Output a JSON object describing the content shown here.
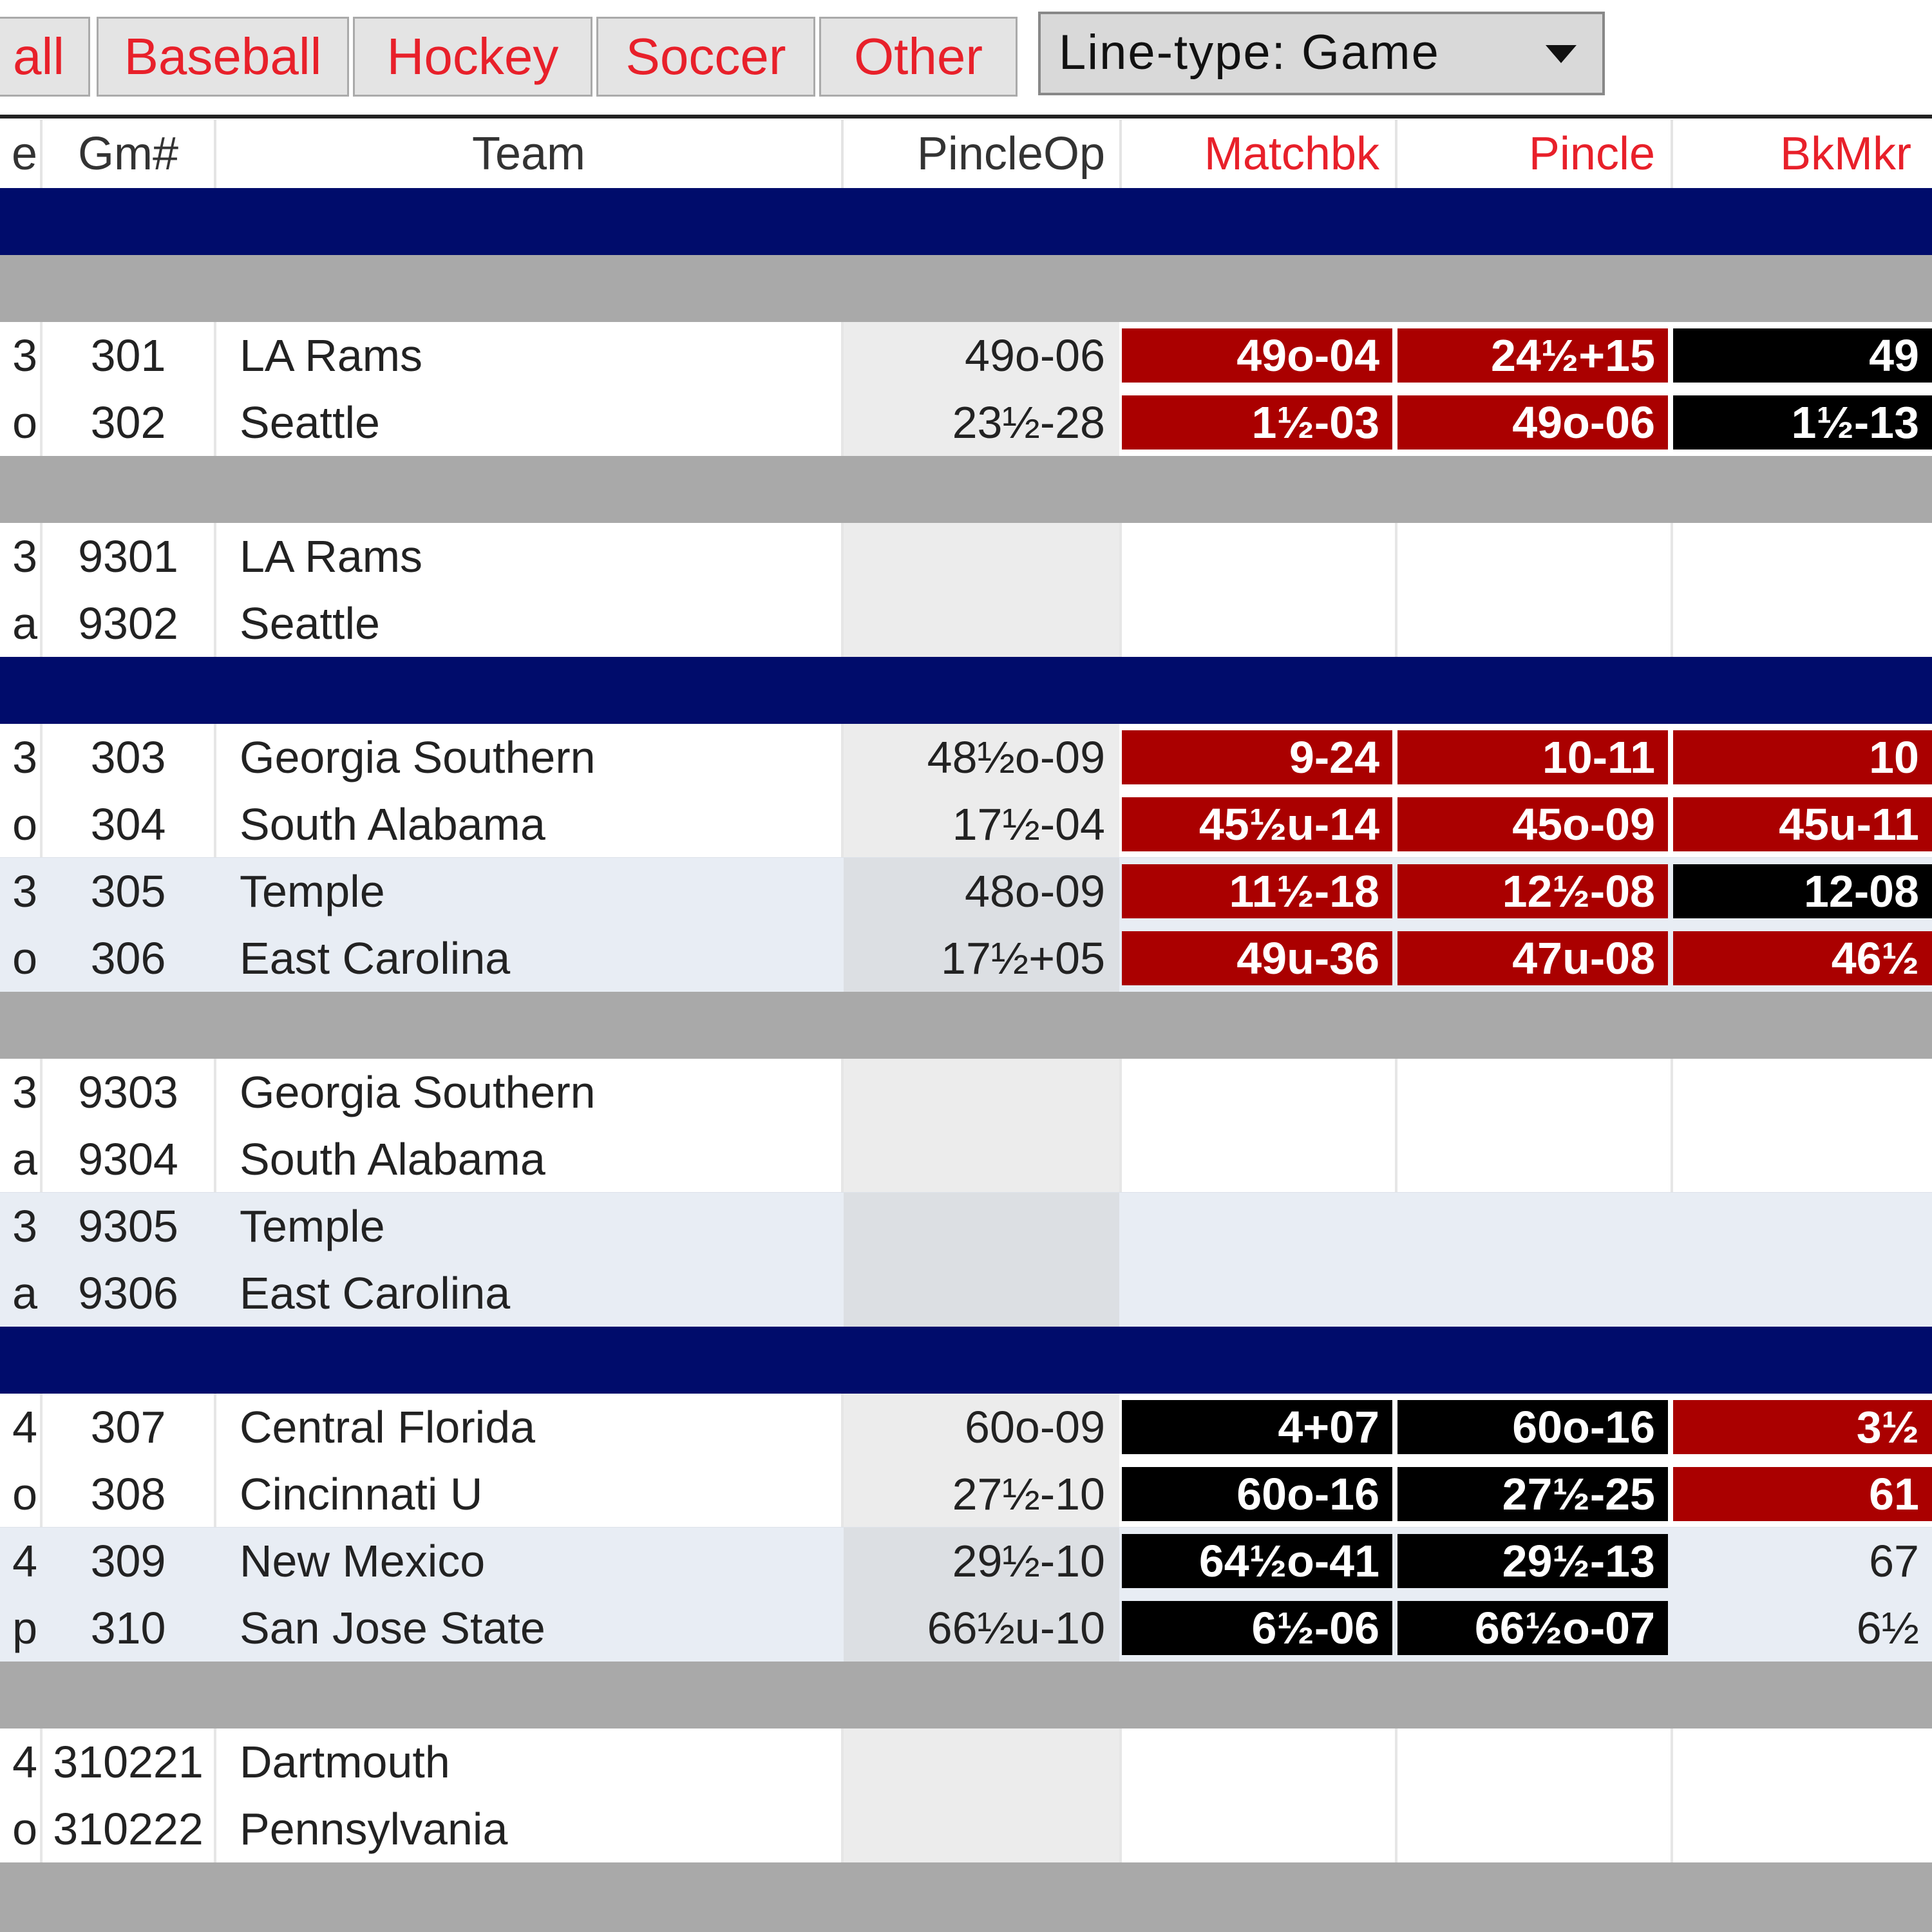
{
  "tabs": [
    "all",
    "Baseball",
    "Hockey",
    "Soccer",
    "Other"
  ],
  "line_type": {
    "label": "Line-type: Game"
  },
  "headers": {
    "left": "e",
    "gm": "Gm#",
    "team": "Team",
    "op": "PincleOp",
    "mb": "Matchbk",
    "pn": "Pincle",
    "bk": "BkMkr"
  },
  "rows": [
    {
      "left": "3",
      "gm": "301",
      "team": "LA Rams",
      "op": "49o-06",
      "mb": "49o-04",
      "pn": "24½+15",
      "bk": "49"
    },
    {
      "left": "o",
      "gm": "302",
      "team": "Seattle",
      "op": "23½-28",
      "mb": "1½-03",
      "pn": "49o-06",
      "bk": "1½-13"
    },
    {
      "left": "3",
      "gm": "9301",
      "team": "LA Rams",
      "op": "",
      "mb": "",
      "pn": "",
      "bk": ""
    },
    {
      "left": "a",
      "gm": "9302",
      "team": "Seattle",
      "op": "",
      "mb": "",
      "pn": "",
      "bk": ""
    },
    {
      "left": "3",
      "gm": "303",
      "team": "Georgia Southern",
      "op": "48½o-09",
      "mb": "9-24",
      "pn": "10-11",
      "bk": "10"
    },
    {
      "left": "o",
      "gm": "304",
      "team": "South Alabama",
      "op": "17½-04",
      "mb": "45½u-14",
      "pn": "45o-09",
      "bk": "45u-11"
    },
    {
      "left": "3",
      "gm": "305",
      "team": "Temple",
      "op": "48o-09",
      "mb": "11½-18",
      "pn": "12½-08",
      "bk": "12-08"
    },
    {
      "left": "o",
      "gm": "306",
      "team": "East Carolina",
      "op": "17½+05",
      "mb": "49u-36",
      "pn": "47u-08",
      "bk": "46½"
    },
    {
      "left": "3",
      "gm": "9303",
      "team": "Georgia Southern",
      "op": "",
      "mb": "",
      "pn": "",
      "bk": ""
    },
    {
      "left": "a",
      "gm": "9304",
      "team": "South Alabama",
      "op": "",
      "mb": "",
      "pn": "",
      "bk": ""
    },
    {
      "left": "3",
      "gm": "9305",
      "team": "Temple",
      "op": "",
      "mb": "",
      "pn": "",
      "bk": ""
    },
    {
      "left": "a",
      "gm": "9306",
      "team": "East Carolina",
      "op": "",
      "mb": "",
      "pn": "",
      "bk": ""
    },
    {
      "left": "4",
      "gm": "307",
      "team": "Central Florida",
      "op": "60o-09",
      "mb": "4+07",
      "pn": "60o-16",
      "bk": "3½"
    },
    {
      "left": "o",
      "gm": "308",
      "team": "Cincinnati U",
      "op": "27½-10",
      "mb": "60o-16",
      "pn": "27½-25",
      "bk": "61"
    },
    {
      "left": "4",
      "gm": "309",
      "team": "New Mexico",
      "op": "29½-10",
      "mb": "64½o-41",
      "pn": "29½-13",
      "bk": "67"
    },
    {
      "left": "p",
      "gm": "310",
      "team": "San Jose State",
      "op": "66½u-10",
      "mb": "6½-06",
      "pn": "66½o-07",
      "bk": "6½"
    },
    {
      "left": "4",
      "gm": "310221",
      "team": "Dartmouth",
      "op": "",
      "mb": "",
      "pn": "",
      "bk": ""
    },
    {
      "left": "o",
      "gm": "310222",
      "team": "Pennsylvania",
      "op": "",
      "mb": "",
      "pn": "",
      "bk": ""
    }
  ],
  "colors": {
    "highlight_red": "#aa0000",
    "highlight_black": "#000000",
    "navy_band": "#000c6b",
    "grey_band": "#a9a9a9",
    "tab_text": "#e8202a"
  }
}
